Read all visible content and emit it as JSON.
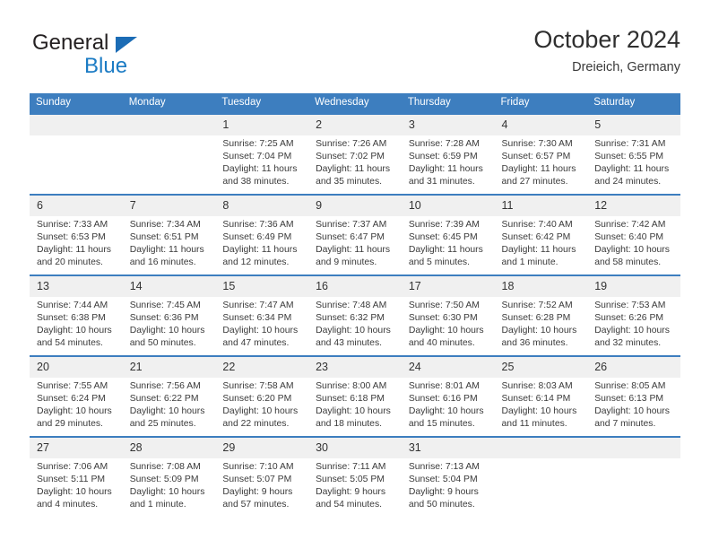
{
  "logo": {
    "primary_text": "General",
    "secondary_text": "Blue",
    "triangle_icon": "blue-triangle-icon",
    "primary_color": "#231f20",
    "secondary_color": "#1b7bc4"
  },
  "header": {
    "title": "October 2024",
    "location": "Dreieich, Germany"
  },
  "theme": {
    "header_blue": "#3d7ebf",
    "daynum_gray": "#f0f0f0",
    "text_color": "#3a3a3a"
  },
  "weekday_headers": [
    "Sunday",
    "Monday",
    "Tuesday",
    "Wednesday",
    "Thursday",
    "Friday",
    "Saturday"
  ],
  "weeks": [
    [
      {
        "day": "",
        "sunrise": "",
        "sunset": "",
        "daylight1": "",
        "daylight2": ""
      },
      {
        "day": "",
        "sunrise": "",
        "sunset": "",
        "daylight1": "",
        "daylight2": ""
      },
      {
        "day": "1",
        "sunrise": "Sunrise: 7:25 AM",
        "sunset": "Sunset: 7:04 PM",
        "daylight1": "Daylight: 11 hours",
        "daylight2": "and 38 minutes."
      },
      {
        "day": "2",
        "sunrise": "Sunrise: 7:26 AM",
        "sunset": "Sunset: 7:02 PM",
        "daylight1": "Daylight: 11 hours",
        "daylight2": "and 35 minutes."
      },
      {
        "day": "3",
        "sunrise": "Sunrise: 7:28 AM",
        "sunset": "Sunset: 6:59 PM",
        "daylight1": "Daylight: 11 hours",
        "daylight2": "and 31 minutes."
      },
      {
        "day": "4",
        "sunrise": "Sunrise: 7:30 AM",
        "sunset": "Sunset: 6:57 PM",
        "daylight1": "Daylight: 11 hours",
        "daylight2": "and 27 minutes."
      },
      {
        "day": "5",
        "sunrise": "Sunrise: 7:31 AM",
        "sunset": "Sunset: 6:55 PM",
        "daylight1": "Daylight: 11 hours",
        "daylight2": "and 24 minutes."
      }
    ],
    [
      {
        "day": "6",
        "sunrise": "Sunrise: 7:33 AM",
        "sunset": "Sunset: 6:53 PM",
        "daylight1": "Daylight: 11 hours",
        "daylight2": "and 20 minutes."
      },
      {
        "day": "7",
        "sunrise": "Sunrise: 7:34 AM",
        "sunset": "Sunset: 6:51 PM",
        "daylight1": "Daylight: 11 hours",
        "daylight2": "and 16 minutes."
      },
      {
        "day": "8",
        "sunrise": "Sunrise: 7:36 AM",
        "sunset": "Sunset: 6:49 PM",
        "daylight1": "Daylight: 11 hours",
        "daylight2": "and 12 minutes."
      },
      {
        "day": "9",
        "sunrise": "Sunrise: 7:37 AM",
        "sunset": "Sunset: 6:47 PM",
        "daylight1": "Daylight: 11 hours",
        "daylight2": "and 9 minutes."
      },
      {
        "day": "10",
        "sunrise": "Sunrise: 7:39 AM",
        "sunset": "Sunset: 6:45 PM",
        "daylight1": "Daylight: 11 hours",
        "daylight2": "and 5 minutes."
      },
      {
        "day": "11",
        "sunrise": "Sunrise: 7:40 AM",
        "sunset": "Sunset: 6:42 PM",
        "daylight1": "Daylight: 11 hours",
        "daylight2": "and 1 minute."
      },
      {
        "day": "12",
        "sunrise": "Sunrise: 7:42 AM",
        "sunset": "Sunset: 6:40 PM",
        "daylight1": "Daylight: 10 hours",
        "daylight2": "and 58 minutes."
      }
    ],
    [
      {
        "day": "13",
        "sunrise": "Sunrise: 7:44 AM",
        "sunset": "Sunset: 6:38 PM",
        "daylight1": "Daylight: 10 hours",
        "daylight2": "and 54 minutes."
      },
      {
        "day": "14",
        "sunrise": "Sunrise: 7:45 AM",
        "sunset": "Sunset: 6:36 PM",
        "daylight1": "Daylight: 10 hours",
        "daylight2": "and 50 minutes."
      },
      {
        "day": "15",
        "sunrise": "Sunrise: 7:47 AM",
        "sunset": "Sunset: 6:34 PM",
        "daylight1": "Daylight: 10 hours",
        "daylight2": "and 47 minutes."
      },
      {
        "day": "16",
        "sunrise": "Sunrise: 7:48 AM",
        "sunset": "Sunset: 6:32 PM",
        "daylight1": "Daylight: 10 hours",
        "daylight2": "and 43 minutes."
      },
      {
        "day": "17",
        "sunrise": "Sunrise: 7:50 AM",
        "sunset": "Sunset: 6:30 PM",
        "daylight1": "Daylight: 10 hours",
        "daylight2": "and 40 minutes."
      },
      {
        "day": "18",
        "sunrise": "Sunrise: 7:52 AM",
        "sunset": "Sunset: 6:28 PM",
        "daylight1": "Daylight: 10 hours",
        "daylight2": "and 36 minutes."
      },
      {
        "day": "19",
        "sunrise": "Sunrise: 7:53 AM",
        "sunset": "Sunset: 6:26 PM",
        "daylight1": "Daylight: 10 hours",
        "daylight2": "and 32 minutes."
      }
    ],
    [
      {
        "day": "20",
        "sunrise": "Sunrise: 7:55 AM",
        "sunset": "Sunset: 6:24 PM",
        "daylight1": "Daylight: 10 hours",
        "daylight2": "and 29 minutes."
      },
      {
        "day": "21",
        "sunrise": "Sunrise: 7:56 AM",
        "sunset": "Sunset: 6:22 PM",
        "daylight1": "Daylight: 10 hours",
        "daylight2": "and 25 minutes."
      },
      {
        "day": "22",
        "sunrise": "Sunrise: 7:58 AM",
        "sunset": "Sunset: 6:20 PM",
        "daylight1": "Daylight: 10 hours",
        "daylight2": "and 22 minutes."
      },
      {
        "day": "23",
        "sunrise": "Sunrise: 8:00 AM",
        "sunset": "Sunset: 6:18 PM",
        "daylight1": "Daylight: 10 hours",
        "daylight2": "and 18 minutes."
      },
      {
        "day": "24",
        "sunrise": "Sunrise: 8:01 AM",
        "sunset": "Sunset: 6:16 PM",
        "daylight1": "Daylight: 10 hours",
        "daylight2": "and 15 minutes."
      },
      {
        "day": "25",
        "sunrise": "Sunrise: 8:03 AM",
        "sunset": "Sunset: 6:14 PM",
        "daylight1": "Daylight: 10 hours",
        "daylight2": "and 11 minutes."
      },
      {
        "day": "26",
        "sunrise": "Sunrise: 8:05 AM",
        "sunset": "Sunset: 6:13 PM",
        "daylight1": "Daylight: 10 hours",
        "daylight2": "and 7 minutes."
      }
    ],
    [
      {
        "day": "27",
        "sunrise": "Sunrise: 7:06 AM",
        "sunset": "Sunset: 5:11 PM",
        "daylight1": "Daylight: 10 hours",
        "daylight2": "and 4 minutes."
      },
      {
        "day": "28",
        "sunrise": "Sunrise: 7:08 AM",
        "sunset": "Sunset: 5:09 PM",
        "daylight1": "Daylight: 10 hours",
        "daylight2": "and 1 minute."
      },
      {
        "day": "29",
        "sunrise": "Sunrise: 7:10 AM",
        "sunset": "Sunset: 5:07 PM",
        "daylight1": "Daylight: 9 hours",
        "daylight2": "and 57 minutes."
      },
      {
        "day": "30",
        "sunrise": "Sunrise: 7:11 AM",
        "sunset": "Sunset: 5:05 PM",
        "daylight1": "Daylight: 9 hours",
        "daylight2": "and 54 minutes."
      },
      {
        "day": "31",
        "sunrise": "Sunrise: 7:13 AM",
        "sunset": "Sunset: 5:04 PM",
        "daylight1": "Daylight: 9 hours",
        "daylight2": "and 50 minutes."
      },
      {
        "day": "",
        "sunrise": "",
        "sunset": "",
        "daylight1": "",
        "daylight2": ""
      },
      {
        "day": "",
        "sunrise": "",
        "sunset": "",
        "daylight1": "",
        "daylight2": ""
      }
    ]
  ]
}
